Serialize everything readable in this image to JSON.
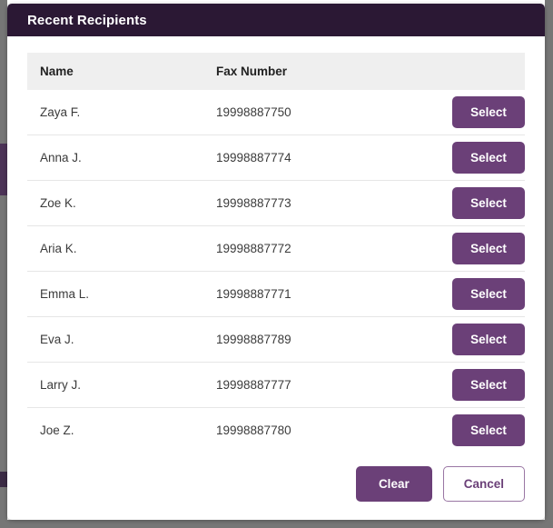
{
  "dialog": {
    "title": "Recent Recipients"
  },
  "table": {
    "headers": {
      "name": "Name",
      "fax": "Fax Number",
      "action": ""
    },
    "select_label": "Select",
    "rows": [
      {
        "name": "Zaya F.",
        "fax": "19998887750",
        "select": "Select"
      },
      {
        "name": "Anna J.",
        "fax": "19998887774",
        "select": "Select"
      },
      {
        "name": "Zoe K.",
        "fax": "19998887773",
        "select": "Select"
      },
      {
        "name": "Aria K.",
        "fax": "19998887772",
        "select": "Select"
      },
      {
        "name": "Emma L.",
        "fax": "19998887771",
        "select": "Select"
      },
      {
        "name": "Eva J.",
        "fax": "19998887789",
        "select": "Select"
      },
      {
        "name": "Larry J.",
        "fax": "19998887777",
        "select": "Select"
      },
      {
        "name": "Joe Z.",
        "fax": "19998887780",
        "select": "Select"
      }
    ]
  },
  "footer": {
    "clear_label": "Clear",
    "cancel_label": "Cancel"
  },
  "colors": {
    "header_bar": "#2b1834",
    "accent_purple": "#6b4078",
    "cancel_border": "#9a76a4",
    "table_header_bg": "#efefef",
    "row_divider": "#e6e6e6",
    "page_backdrop": "#767676",
    "behind_strip": "#4c3357"
  }
}
